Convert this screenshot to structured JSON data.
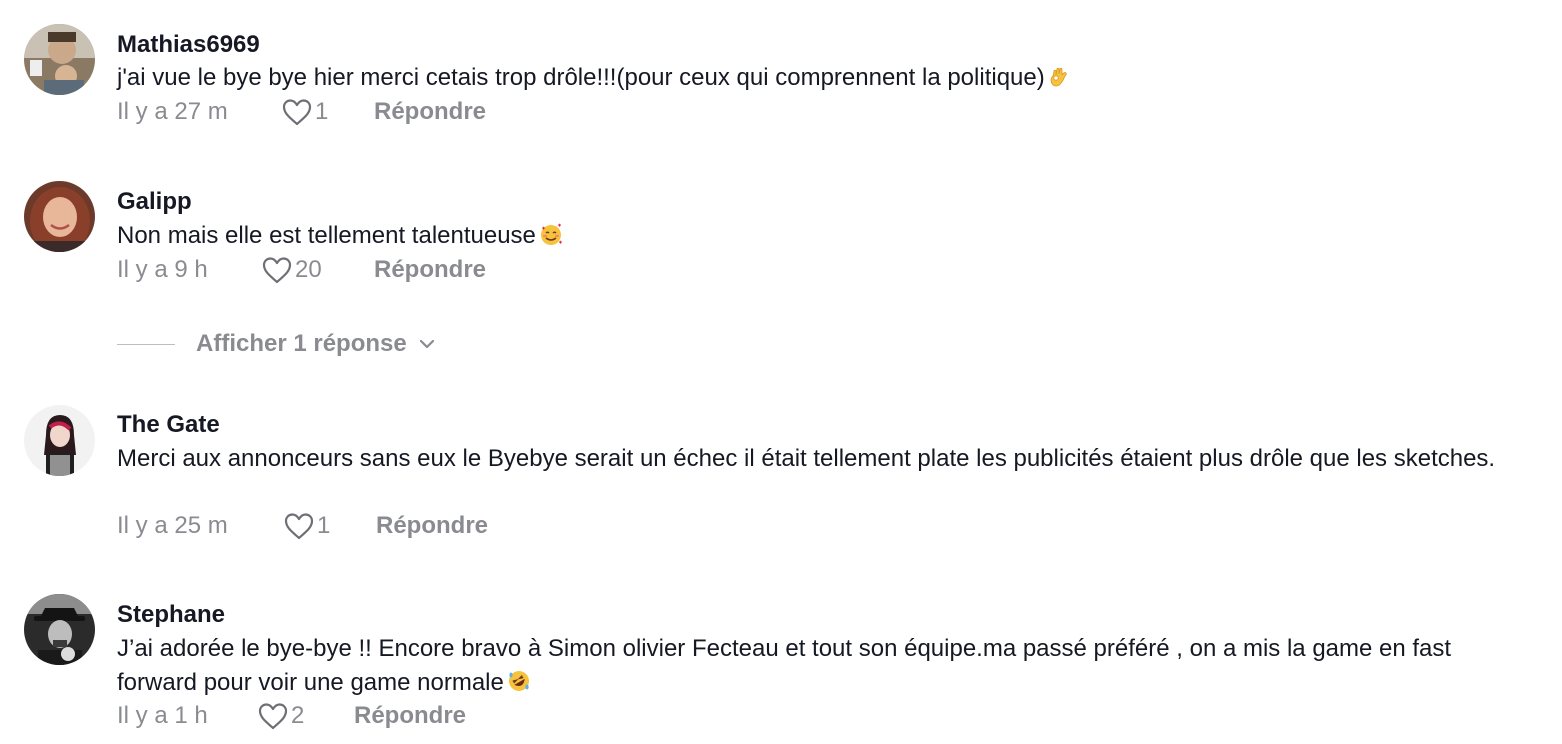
{
  "comments": [
    {
      "username": "Mathias6969",
      "text": "j'ai vue le bye bye hier merci cetais trop drôle!!!(pour ceux qui comprennent la politique)",
      "emoji": "ok-hand-emoji",
      "time": "Il y a 27 m",
      "likes": "1",
      "reply": "Répondre"
    },
    {
      "username": "Galipp",
      "text": "Non mais elle est tellement talentueuse",
      "emoji": "smiling-face-with-hearts-emoji",
      "time": "Il y a 9 h",
      "likes": "20",
      "reply": "Répondre",
      "view_replies": "Afficher 1 réponse"
    },
    {
      "username": "The Gate",
      "text": "Merci aux annonceurs sans eux le Byebye serait un échec il était tellement plate les publicités étaient plus drôle que les sketches.",
      "time": "Il y a 25 m",
      "likes": "1",
      "reply": "Répondre"
    },
    {
      "username": "Stephane",
      "text": "J’ai adorée le bye-bye !! Encore bravo à Simon olivier Fecteau et tout son équipe.ma passé préféré , on a mis la game en fast forward pour voir une game normale",
      "emoji": "rolling-on-floor-laughing-emoji",
      "time": "Il y a 1 h",
      "likes": "2",
      "reply": "Répondre"
    }
  ],
  "icons": {
    "like": "heart-outline-icon",
    "expand": "chevron-down-icon"
  },
  "colors": {
    "text": "#161823",
    "muted": "#8a8b91"
  }
}
